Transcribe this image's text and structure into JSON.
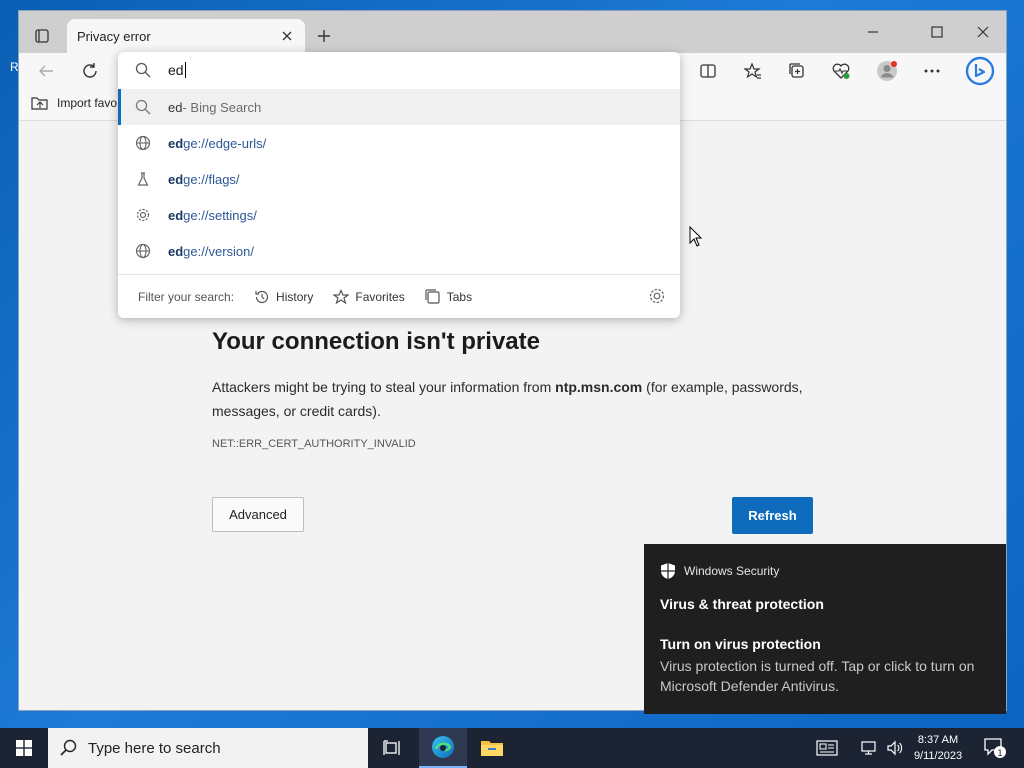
{
  "desktop": {
    "icon_label_fragment": "R"
  },
  "browser": {
    "tab": {
      "title": "Privacy error"
    },
    "favorites_bar": {
      "import_label": "Import favo"
    }
  },
  "omnibox": {
    "value": "ed",
    "suggestions": [
      {
        "match": "ed",
        "rest": "",
        "suffix": " - Bing Search",
        "icon": "search-icon"
      },
      {
        "match": "ed",
        "rest": "ge://edge-urls/",
        "icon": "globe-icon"
      },
      {
        "match": "ed",
        "rest": "ge://flags/",
        "icon": "flask-icon"
      },
      {
        "match": "ed",
        "rest": "ge://settings/",
        "icon": "gear-icon"
      },
      {
        "match": "ed",
        "rest": "ge://version/",
        "icon": "globe-icon"
      }
    ],
    "filter": {
      "label": "Filter your search:",
      "history": "History",
      "favorites": "Favorites",
      "tabs": "Tabs"
    }
  },
  "page": {
    "title": "Your connection isn't private",
    "desc_before": "Attackers might be trying to steal your information from ",
    "domain": "ntp.msn.com",
    "desc_after": " (for example, passwords, messages, or credit cards).",
    "error_code": "NET::ERR_CERT_AUTHORITY_INVALID",
    "advanced_label": "Advanced",
    "refresh_label": "Refresh"
  },
  "toast": {
    "app_name": "Windows Security",
    "header": "Virus & threat protection",
    "title": "Turn on virus protection",
    "body": "Virus protection is turned off. Tap or click to turn on Microsoft Defender Antivirus."
  },
  "taskbar": {
    "search_placeholder": "Type here to search",
    "time": "8:37 AM",
    "date": "9/11/2023",
    "notification_count": "1"
  },
  "colors": {
    "accent": "#0f6cbd",
    "desktop": "#0a5fb4",
    "taskbar": "#1c2333",
    "toast": "#1f1f1f"
  }
}
